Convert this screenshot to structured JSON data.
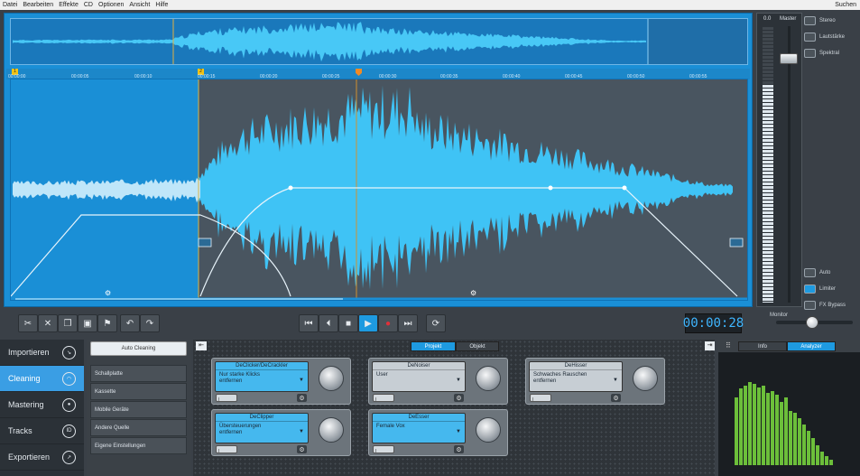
{
  "menu": [
    "Datei",
    "Bearbeiten",
    "Effekte",
    "CD",
    "Optionen",
    "Ansicht",
    "Hilfe"
  ],
  "search_label": "Suchen",
  "ruler_ticks": [
    "00:00:00",
    "00:00:05",
    "00:00:10",
    "00:00:15",
    "00:00:20",
    "00:00:25",
    "00:00:30",
    "00:00:35",
    "00:00:40",
    "00:00:45",
    "00:00:50",
    "00:00:55"
  ],
  "markers": [
    "1",
    "2"
  ],
  "master": {
    "level": "0.0",
    "title": "Master"
  },
  "view_buttons": [
    "Stereo",
    "Lautstärke",
    "Spektral"
  ],
  "fx_buttons": [
    "Auto",
    "Limiter",
    "FX Bypass"
  ],
  "monitor_label": "Monitor",
  "time_display": "00:00:28",
  "nav": [
    {
      "label": "Importieren",
      "icon": "import-icon"
    },
    {
      "label": "Cleaning",
      "icon": "cleaning-icon"
    },
    {
      "label": "Mastering",
      "icon": "mastering-icon"
    },
    {
      "label": "Tracks",
      "icon": "tracks-icon",
      "glyph": "ID"
    },
    {
      "label": "Exportieren",
      "icon": "export-icon"
    }
  ],
  "auto_cleaning": "Auto Cleaning",
  "presets": [
    "Schallplatte",
    "Kassette",
    "Mobile Geräte",
    "Andere Quelle",
    "Eigene Einstellungen"
  ],
  "tabs": {
    "project": "Projekt",
    "object": "Objekt",
    "info": "Info",
    "analyzer": "Analyzer"
  },
  "modules": [
    {
      "title": "DeClicker/DeCrackler",
      "value": "Nur starke Klicks\nentfernen",
      "on": true
    },
    {
      "title": "DeNoiser",
      "value": "User",
      "on": false
    },
    {
      "title": "DeHisser",
      "value": "Schwaches Rauschen\nentfernen",
      "on": false
    },
    {
      "title": "DeClipper",
      "value": "Übersteuerungen\nentfernen",
      "on": true
    },
    {
      "title": "DeEsser",
      "value": "Female Vox",
      "on": true
    }
  ],
  "toggle_glyph": "I",
  "gear_glyph": "⚙",
  "colors": {
    "accent": "#1e9ae0",
    "waveform": "#3fc3f5",
    "analyzer_bar": "#6cbf3a"
  }
}
